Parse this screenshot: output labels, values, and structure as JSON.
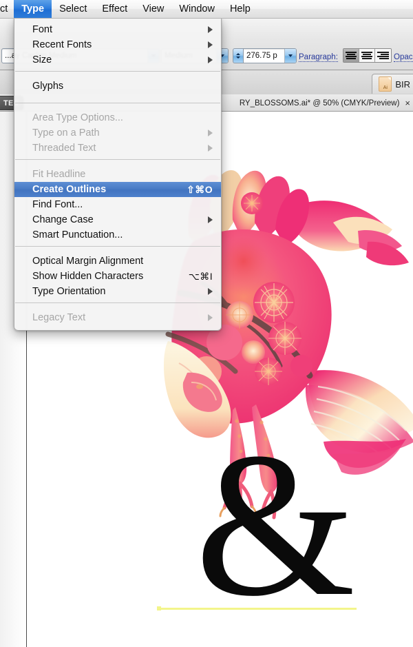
{
  "app": {
    "name": "Adobe Illustrator",
    "accent_blue": "#2f7ede",
    "menu_highlight": "#4679c4",
    "baseline_yellow": "#f3f58a"
  },
  "menubar": {
    "items": [
      {
        "label": "ct",
        "active": false,
        "clipped": true
      },
      {
        "label": "Type",
        "active": true
      },
      {
        "label": "Select",
        "active": false
      },
      {
        "label": "Effect",
        "active": false
      },
      {
        "label": "View",
        "active": false
      },
      {
        "label": "Window",
        "active": false
      },
      {
        "label": "Help",
        "active": false
      }
    ]
  },
  "control_bar": {
    "font_family_value": "...ay Caslon Medium",
    "font_style_value": "Medium",
    "font_size_value": "276.75 p",
    "paragraph_label": "Paragraph:",
    "align_buttons": [
      {
        "name": "align-left",
        "active": true
      },
      {
        "name": "align-center",
        "active": false
      },
      {
        "name": "align-right",
        "active": false
      }
    ],
    "opacity_label": "Opac"
  },
  "tab_strip": {
    "tabs": [
      {
        "label": "BIR",
        "icon": "ai-document-icon",
        "active": true
      }
    ]
  },
  "document_bar": {
    "left_tab_label": "TES",
    "title": "RY_BLOSSOMS.ai* @ 50% (CMYK/Preview)",
    "close_label": "×"
  },
  "type_menu": {
    "title": "Type",
    "items": [
      {
        "label": "Font",
        "submenu": true,
        "enabled": true,
        "shortcut": ""
      },
      {
        "label": "Recent Fonts",
        "submenu": true,
        "enabled": true,
        "shortcut": ""
      },
      {
        "label": "Size",
        "submenu": true,
        "enabled": true,
        "shortcut": ""
      },
      {
        "label": "Glyphs",
        "submenu": false,
        "enabled": true,
        "shortcut": ""
      },
      {
        "label": "Area Type Options...",
        "submenu": false,
        "enabled": false,
        "shortcut": ""
      },
      {
        "label": "Type on a Path",
        "submenu": true,
        "enabled": false,
        "shortcut": ""
      },
      {
        "label": "Threaded Text",
        "submenu": true,
        "enabled": false,
        "shortcut": ""
      },
      {
        "label": "Fit Headline",
        "submenu": false,
        "enabled": false,
        "shortcut": ""
      },
      {
        "label": "Create Outlines",
        "submenu": false,
        "enabled": true,
        "shortcut": "⇧⌘O",
        "selected": true
      },
      {
        "label": "Find Font...",
        "submenu": false,
        "enabled": true,
        "shortcut": ""
      },
      {
        "label": "Change Case",
        "submenu": true,
        "enabled": true,
        "shortcut": ""
      },
      {
        "label": "Smart Punctuation...",
        "submenu": false,
        "enabled": true,
        "shortcut": ""
      },
      {
        "label": "Optical Margin Alignment",
        "submenu": false,
        "enabled": true,
        "shortcut": ""
      },
      {
        "label": "Show Hidden Characters",
        "submenu": false,
        "enabled": true,
        "shortcut": "⌥⌘I"
      },
      {
        "label": "Type Orientation",
        "submenu": true,
        "enabled": true,
        "shortcut": ""
      },
      {
        "label": "Legacy Text",
        "submenu": true,
        "enabled": false,
        "shortcut": ""
      }
    ]
  },
  "canvas": {
    "artwork_name": "cherry-blossom-bird-illustration",
    "artwork_colors": [
      "#ef3f7d",
      "#f7719c",
      "#fbd9b0",
      "#fdf2d8",
      "#e8456b",
      "#6d4a4a"
    ],
    "text_object": "&",
    "text_baseline_color": "#f3f58a",
    "zoom_level": "50%",
    "color_mode": "CMYK/Preview"
  }
}
